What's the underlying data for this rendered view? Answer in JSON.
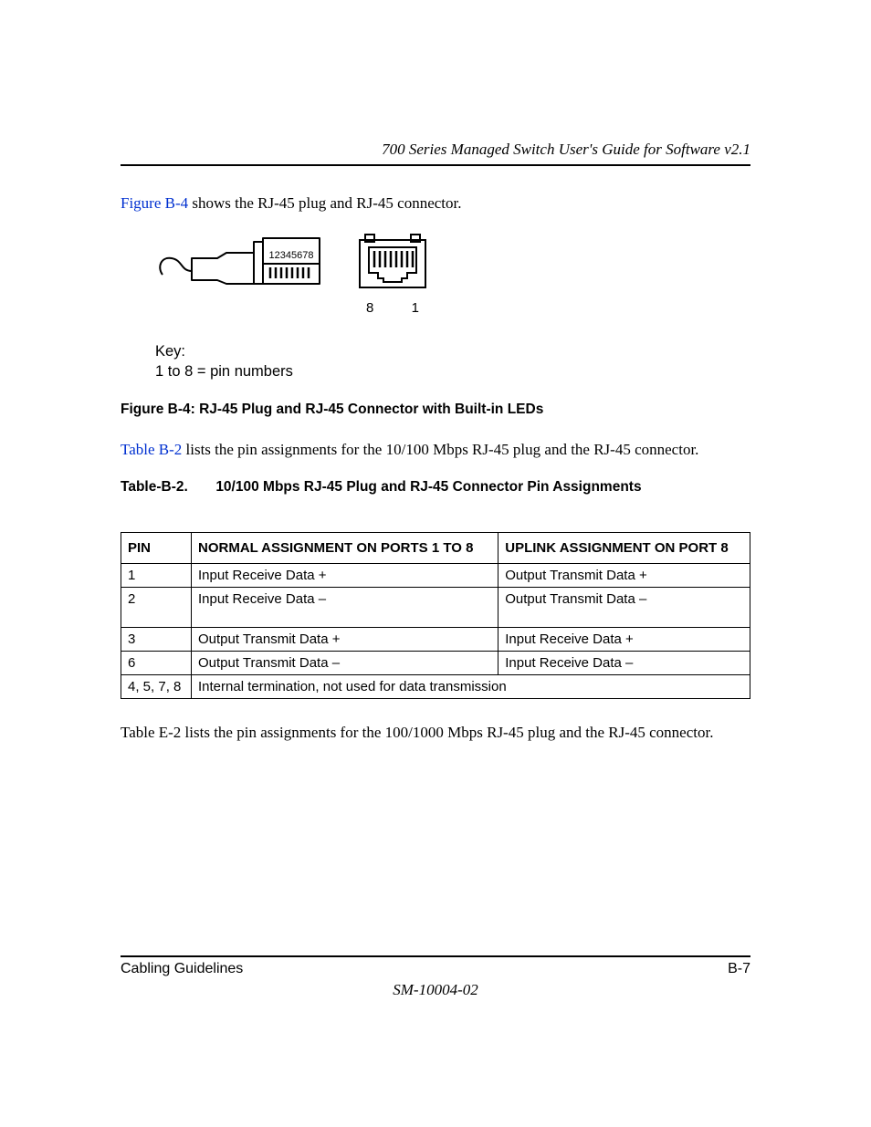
{
  "header": {
    "running_title": "700 Series Managed Switch User's Guide for Software v2.1"
  },
  "intro_para": {
    "link_text": "Figure B-4",
    "rest": " shows the RJ-45 plug and RJ-45 connector."
  },
  "figure": {
    "plug_pin_labels": "12345678",
    "jack_label_left": "8",
    "jack_label_right": "1",
    "key_title": "Key:",
    "key_line": " 1 to 8 = pin numbers",
    "caption": "Figure B-4:  RJ-45 Plug and RJ-45 Connector with Built-in LEDs"
  },
  "table_intro": {
    "link_text": "Table B-2",
    "rest": " lists the pin assignments for the 10/100 Mbps RJ-45 plug and the RJ-45 connector."
  },
  "table": {
    "caption_label": "Table-B-2.",
    "caption_title": "10/100 Mbps RJ-45 Plug and RJ-45 Connector Pin Assignments",
    "headers": {
      "pin": "PIN",
      "normal": "NORMAL ASSIGNMENT ON PORTS 1 TO 8",
      "uplink": "UPLINK ASSIGNMENT ON PORT 8"
    },
    "rows": [
      {
        "pin": "1",
        "normal": "Input Receive Data +",
        "uplink": "Output Transmit Data +",
        "tall": false
      },
      {
        "pin": "2",
        "normal": "Input Receive Data –",
        "uplink": "Output Transmit Data –",
        "tall": true
      },
      {
        "pin": "3",
        "normal": "Output Transmit Data +",
        "uplink": "Input Receive Data +",
        "tall": false
      },
      {
        "pin": "6",
        "normal": "Output Transmit Data –",
        "uplink": "Input Receive Data –",
        "tall": false
      }
    ],
    "merged_row": {
      "pin": "4, 5, 7, 8",
      "text": "Internal termination, not used for data transmission"
    }
  },
  "closing_para": "Table E-2 lists the pin assignments for the 100/1000 Mbps RJ-45 plug and the RJ-45 connector.",
  "footer": {
    "section": "Cabling Guidelines",
    "page": "B-7",
    "doc_id": "SM-10004-02"
  }
}
